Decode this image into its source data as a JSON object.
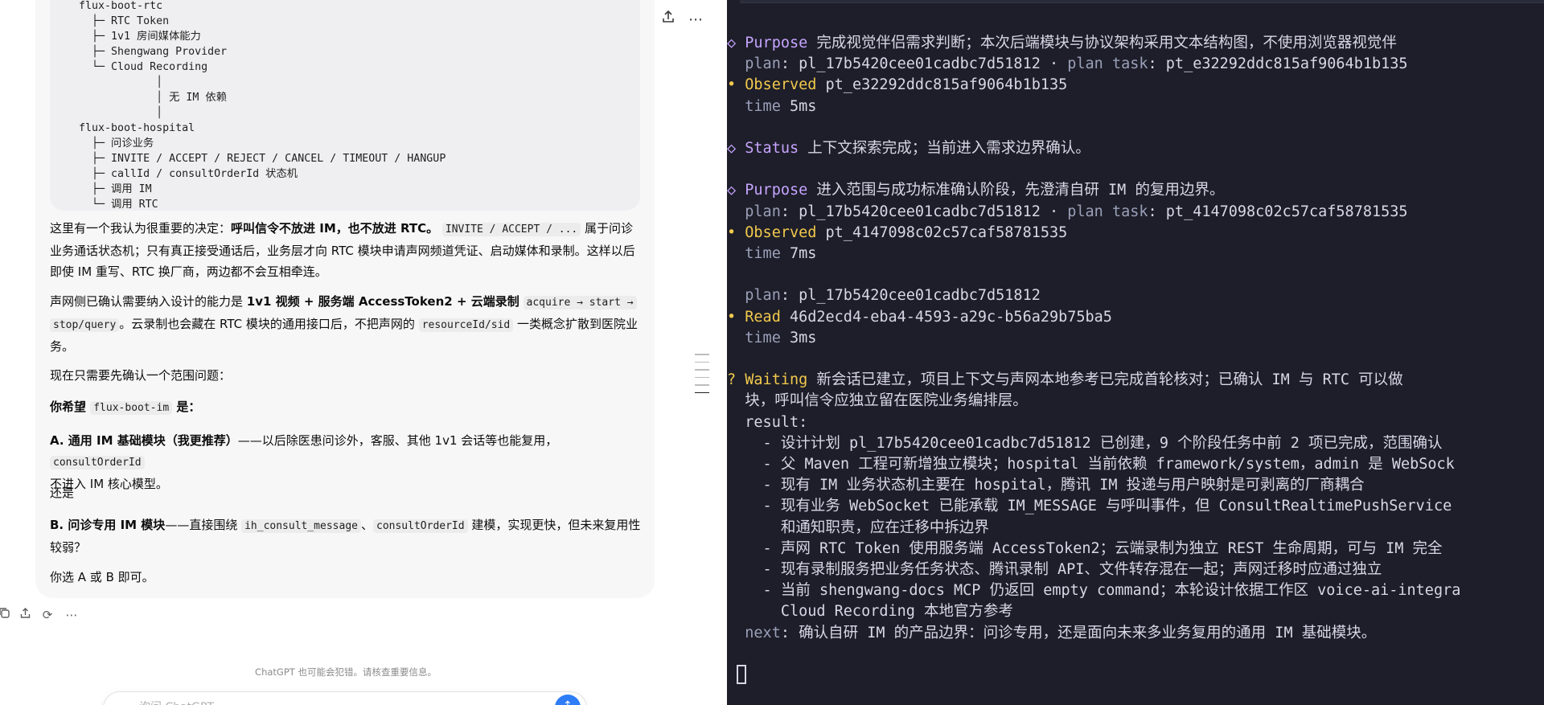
{
  "chat": {
    "code_lines": [
      "  flux-boot-rtc",
      "    ├─ RTC Token",
      "    ├─ 1v1 房间媒体能力",
      "    ├─ Shengwang Provider",
      "    └─ Cloud Recording",
      "              │",
      "              │ 无 IM 依赖",
      "              │",
      "  flux-boot-hospital",
      "    ├─ 问诊业务",
      "    ├─ INVITE / ACCEPT / REJECT / CANCEL / TIMEOUT / HANGUP",
      "    ├─ callId / consultOrderId 状态机",
      "    ├─ 调用 IM",
      "    └─ 调用 RTC"
    ],
    "p1": {
      "pre": "这里有一个我认为很重要的决定：",
      "bold": "呼叫信令不放进 IM，也不放进 RTC。",
      "code": "INVITE / ACCEPT / ...",
      "line1_tail": " 属于问诊",
      "line2": "业务通话状态机；只有真正接受通话后，业务层才向 RTC 模块申请声网频道凭证、启动媒体和录制。这样以后",
      "line3": "即使 IM 重写、RTC 换厂商，两边都不会互相牵连。"
    },
    "p2": {
      "pre": "声网侧已确认需要纳入设计的能力是 ",
      "bold": "1v1 视频 + 服务端 AccessToken2 + 云端录制",
      "code1a": "acquire → start →",
      "code1b": "stop/query",
      "mid": "。云录制也会藏在 RTC 模块的通用接口后，不把声网的 ",
      "code2": "resourceId/sid",
      "tail": " 一类概念扩散到医院业",
      "line3": "务。"
    },
    "p3": "现在只需要先确认一个范围问题：",
    "p4": {
      "pre": "你希望 ",
      "code": "flux-boot-im",
      "post": " 是："
    },
    "optA": {
      "bold": "A. 通用 IM 基础模块（我更推荐）",
      "text": "——以后除医患问诊外，客服、其他 1v1 会话等也能复用，",
      "code": "consultOrderId",
      "line2": "不进入 IM 核心模型。"
    },
    "or": "还是",
    "optB": {
      "bold": "B. 问诊专用 IM 模块",
      "text": "——直接围绕 ",
      "code1": "ih_consult_message",
      "sep": "、",
      "code2": "consultOrderId",
      "tail": " 建模，实现更快，但未来复用性",
      "line2": "较弱？"
    },
    "closing": "你选 A 或 B 即可。",
    "disclaimer": "ChatGPT 也可能会犯错。请核查重要信息。",
    "composer_placeholder": "询问 ChatGPT"
  },
  "icons": {
    "share": "share-icon",
    "more": "more-icon",
    "copy": "copy-icon",
    "regenerate": "regenerate-icon",
    "send": "send-icon"
  },
  "terminal": {
    "lines": [
      {
        "mark": "◇",
        "key": "Purpose",
        "text": " 完成视觉伴侣需求判断；本次后端模块与协议架构采用文本结构图，不使用浏览器视觉伴"
      },
      {
        "indent": "  ",
        "k1": "plan",
        "v1": ": pl_17b5420cee01cadbc7d51812 · ",
        "k2": "plan task",
        "v2": ": pt_e32292ddc815af9064b1b135"
      },
      {
        "mark": "•",
        "key": "Observed",
        "text": " pt_e32292ddc815af9064b1b135"
      },
      {
        "indent": "  ",
        "k1": "time",
        "v1": " 5ms"
      },
      {
        "blank": true
      },
      {
        "mark": "◇",
        "key": "Status",
        "text": " 上下文探索完成；当前进入需求边界确认。"
      },
      {
        "blank": true
      },
      {
        "mark": "◇",
        "key": "Purpose",
        "text": " 进入范围与成功标准确认阶段，先澄清自研 IM 的复用边界。"
      },
      {
        "indent": "  ",
        "k1": "plan",
        "v1": ": pl_17b5420cee01cadbc7d51812 · ",
        "k2": "plan task",
        "v2": ": pt_4147098c02c57caf58781535"
      },
      {
        "mark": "•",
        "key": "Observed",
        "text": " pt_4147098c02c57caf58781535"
      },
      {
        "indent": "  ",
        "k1": "time",
        "v1": " 7ms"
      },
      {
        "blank": true
      },
      {
        "indent": "  ",
        "k1": "plan",
        "v1": ": pl_17b5420cee01cadbc7d51812"
      },
      {
        "mark": "•",
        "key": "Read",
        "text": " 46d2ecd4-eba4-4593-a29c-b56a29b75ba5"
      },
      {
        "indent": "  ",
        "k1": "time",
        "v1": " 3ms"
      },
      {
        "blank": true
      },
      {
        "mark": "?",
        "key": "Waiting",
        "text": " 新会话已建立，项目上下文与声网本地参考已完成首轮核对；已确认 IM 与 RTC 可以做"
      },
      {
        "plain": "  块，呼叫信令应独立留在医院业务编排层。"
      },
      {
        "plain": "  result:"
      },
      {
        "plain": "    - 设计计划 pl_17b5420cee01cadbc7d51812 已创建，9 个阶段任务中前 2 项已完成，范围确认"
      },
      {
        "plain": "    - 父 Maven 工程可新增独立模块；hospital 当前依赖 framework/system，admin 是 WebSock"
      },
      {
        "plain": "    - 现有 IM 业务状态机主要在 hospital，腾讯 IM 投递与用户映射是可剥离的厂商耦合"
      },
      {
        "plain": "    - 现有业务 WebSocket 已能承载 IM_MESSAGE 与呼叫事件，但 ConsultRealtimePushService"
      },
      {
        "plain": "      和通知职责，应在迁移中拆边界"
      },
      {
        "plain": "    - 声网 RTC Token 使用服务端 AccessToken2；云端录制为独立 REST 生命周期，可与 IM 完全"
      },
      {
        "plain": "    - 现有录制服务把业务任务状态、腾讯录制 API、文件转存混在一起；声网迁移时应通过独立"
      },
      {
        "plain": "    - 当前 shengwang-docs MCP 仍返回 empty command；本轮设计依据工作区 voice-ai-integra"
      },
      {
        "plain": "      Cloud Recording 本地官方参考"
      },
      {
        "indent": "  ",
        "k1": "next",
        "v1": ": 确认自研 IM 的产品边界：问诊专用，还是面向未来多业务复用的通用 IM 基础模块。"
      }
    ]
  },
  "colors": {
    "terminal_bg": "#1d1e29",
    "purple_key": "#c7a4ff",
    "yellow_key": "#f2c94c",
    "send_button": "#2f7df6"
  }
}
